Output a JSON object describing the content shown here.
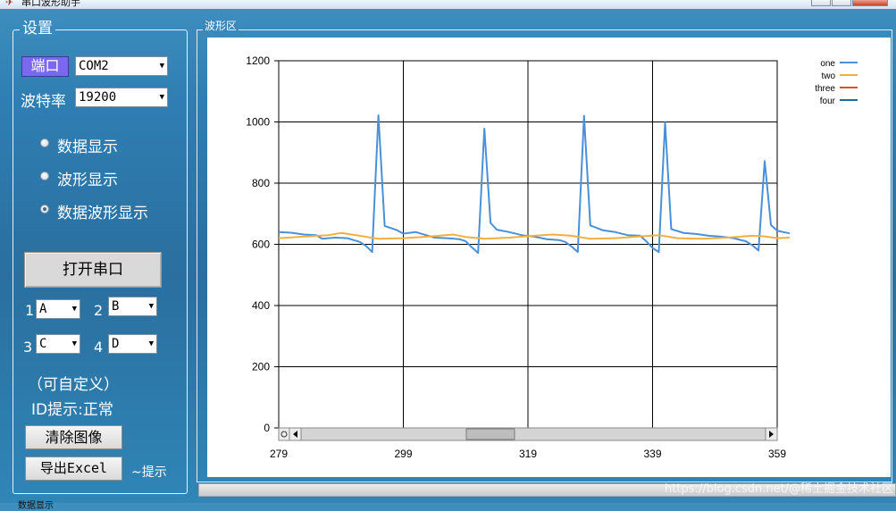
{
  "window": {
    "title": "串口波形助手"
  },
  "settings": {
    "title": "设置",
    "port_label": "端口",
    "port_value": "COM2",
    "baud_label": "波特率",
    "baud_value": "19200",
    "display_modes": [
      "数据显示",
      "波形显示",
      "数据波形显示"
    ],
    "selected_mode": "数据波形显示",
    "open_button": "打开串口",
    "channels": [
      {
        "num": "1",
        "value": "A"
      },
      {
        "num": "2",
        "value": "B"
      },
      {
        "num": "3",
        "value": "C"
      },
      {
        "num": "4",
        "value": "D"
      }
    ],
    "custom_hint": "（可自定义）",
    "id_status": "ID提示:正常",
    "clear_button": "清除图像",
    "export_button": "导出Excel",
    "export_hint": "~提示"
  },
  "wave": {
    "title": "波形区"
  },
  "footer": {
    "label": "数据显示",
    "watermark": "https://blog.csdn.net/@稀土掘金技术社区"
  },
  "colors": {
    "one": "#4a90d9",
    "two": "#f0b040",
    "three": "#d9531e",
    "four": "#1f6a9a",
    "port_button": "#7b68ee"
  },
  "chart_data": {
    "type": "line",
    "x_ticks": [
      279,
      299,
      319,
      339,
      359
    ],
    "y_ticks": [
      0,
      200,
      400,
      600,
      800,
      1000,
      1200
    ],
    "xlim": [
      279,
      359
    ],
    "ylim": [
      0,
      1200
    ],
    "grid": true,
    "legend_position": "top-right",
    "series": [
      {
        "name": "one",
        "color": "#4a90d9",
        "points": [
          [
            279,
            640
          ],
          [
            281,
            638
          ],
          [
            283,
            632
          ],
          [
            285,
            630
          ],
          [
            286,
            618
          ],
          [
            288,
            622
          ],
          [
            290,
            620
          ],
          [
            291,
            614
          ],
          [
            292,
            608
          ],
          [
            293,
            595
          ],
          [
            294,
            575
          ],
          [
            295,
            1022
          ],
          [
            296,
            660
          ],
          [
            298,
            646
          ],
          [
            299,
            635
          ],
          [
            301,
            640
          ],
          [
            303,
            628
          ],
          [
            304,
            622
          ],
          [
            306,
            620
          ],
          [
            308,
            617
          ],
          [
            309,
            610
          ],
          [
            310,
            590
          ],
          [
            311,
            572
          ],
          [
            312,
            978
          ],
          [
            313,
            670
          ],
          [
            314,
            648
          ],
          [
            316,
            640
          ],
          [
            318,
            630
          ],
          [
            320,
            625
          ],
          [
            322,
            617
          ],
          [
            324,
            614
          ],
          [
            325,
            608
          ],
          [
            326,
            593
          ],
          [
            327,
            575
          ],
          [
            328,
            1020
          ],
          [
            329,
            662
          ],
          [
            331,
            646
          ],
          [
            333,
            640
          ],
          [
            335,
            630
          ],
          [
            337,
            628
          ],
          [
            338,
            610
          ],
          [
            339,
            588
          ],
          [
            340,
            575
          ],
          [
            341,
            998
          ],
          [
            342,
            650
          ],
          [
            344,
            637
          ],
          [
            346,
            634
          ],
          [
            348,
            628
          ],
          [
            350,
            625
          ],
          [
            352,
            620
          ],
          [
            354,
            610
          ],
          [
            355,
            597
          ],
          [
            356,
            580
          ],
          [
            357,
            872
          ],
          [
            358,
            663
          ],
          [
            359,
            645
          ],
          [
            360,
            640
          ],
          [
            361,
            636
          ]
        ]
      },
      {
        "name": "two",
        "color": "#f0b040",
        "points": [
          [
            279,
            620
          ],
          [
            283,
            625
          ],
          [
            287,
            630
          ],
          [
            289,
            637
          ],
          [
            292,
            628
          ],
          [
            295,
            618
          ],
          [
            299,
            620
          ],
          [
            303,
            625
          ],
          [
            307,
            632
          ],
          [
            309,
            624
          ],
          [
            312,
            618
          ],
          [
            316,
            622
          ],
          [
            320,
            628
          ],
          [
            323,
            632
          ],
          [
            326,
            628
          ],
          [
            329,
            618
          ],
          [
            333,
            620
          ],
          [
            337,
            626
          ],
          [
            340,
            630
          ],
          [
            343,
            620
          ],
          [
            347,
            618
          ],
          [
            351,
            622
          ],
          [
            355,
            628
          ],
          [
            357,
            626
          ],
          [
            359,
            620
          ],
          [
            361,
            622
          ]
        ]
      },
      {
        "name": "three",
        "color": "#d9531e",
        "points": []
      },
      {
        "name": "four",
        "color": "#1f6a9a",
        "points": []
      }
    ]
  }
}
